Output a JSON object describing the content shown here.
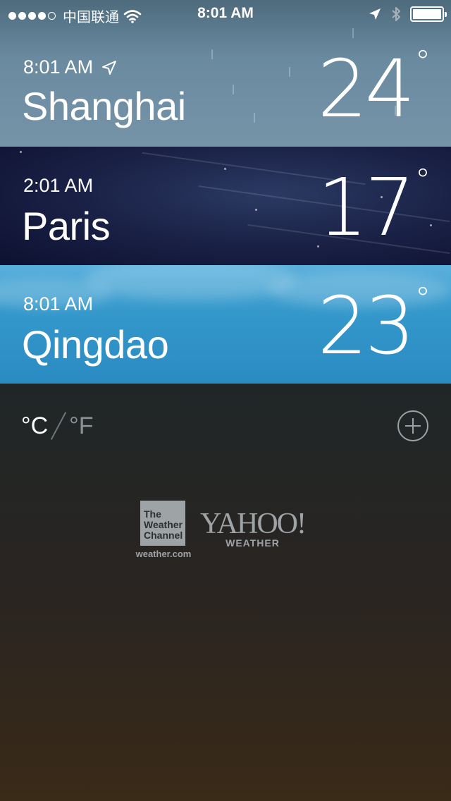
{
  "status_bar": {
    "carrier": "中国联通",
    "time": "8:01 AM",
    "battery_level": 1.0
  },
  "cities": [
    {
      "time": "8:01 AM",
      "name": "Shanghai",
      "temperature": "24",
      "degree_symbol": "°",
      "current_location": true
    },
    {
      "time": "2:01 AM",
      "name": "Paris",
      "temperature": "17",
      "degree_symbol": "°",
      "current_location": false
    },
    {
      "time": "8:01 AM",
      "name": "Qingdao",
      "temperature": "23",
      "degree_symbol": "°",
      "current_location": false
    }
  ],
  "units": {
    "celsius": "°C",
    "fahrenheit": "°F",
    "selected": "celsius"
  },
  "credits": {
    "twc_logo_lines": [
      "The",
      "Weather",
      "Channel"
    ],
    "twc_url": "weather.com",
    "yahoo_word": "YAHOO!",
    "yahoo_sub": "WEATHER"
  },
  "colors": {
    "shanghai_bg": "#6a8aa0",
    "paris_bg": "#1a2146",
    "qingdao_bg": "#3498cb",
    "list_bg": "#1f2628",
    "inactive_unit": "#8a9398"
  }
}
